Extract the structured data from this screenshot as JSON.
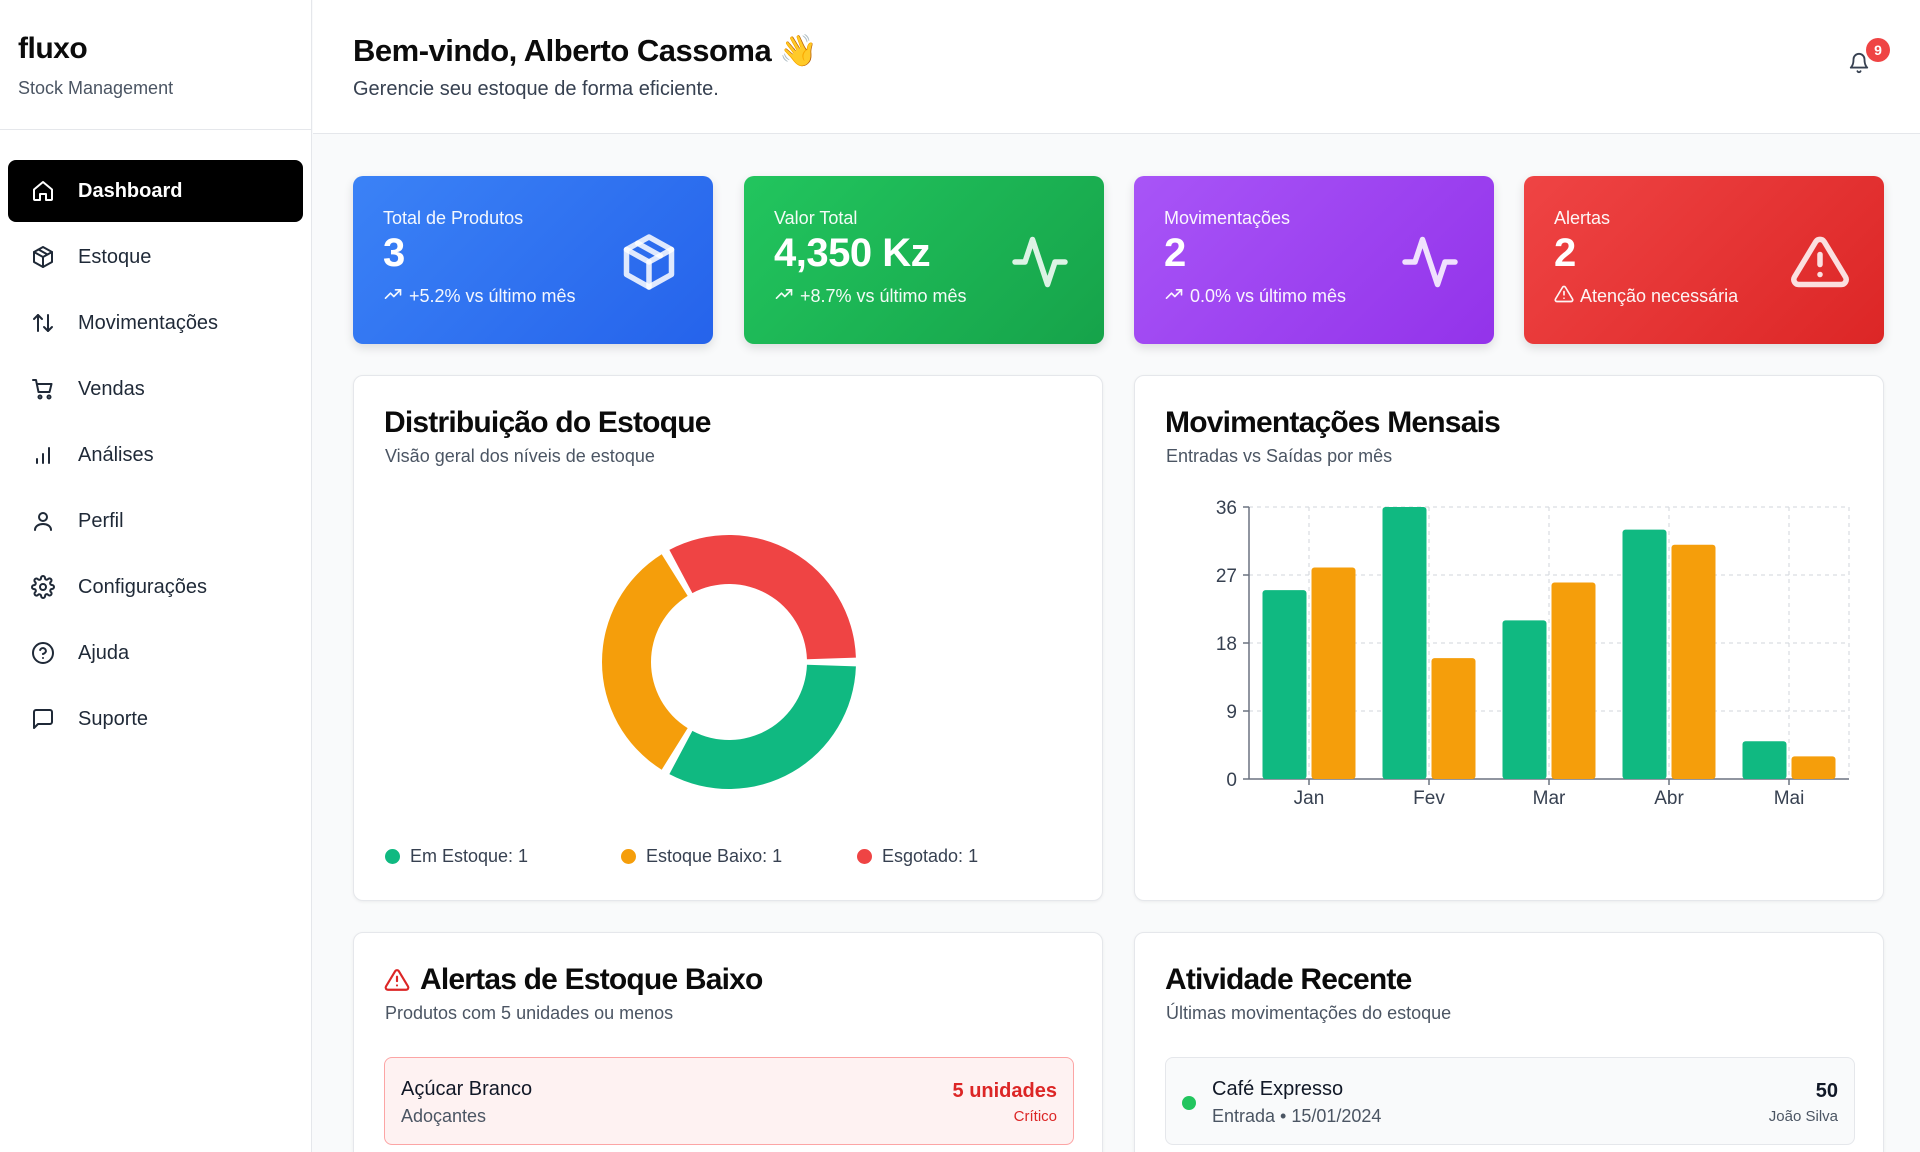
{
  "sidebar": {
    "brand": "fluxo",
    "subtitle": "Stock Management",
    "items": [
      {
        "label": "Dashboard",
        "icon": "home-icon",
        "active": true
      },
      {
        "label": "Estoque",
        "icon": "package-icon"
      },
      {
        "label": "Movimentações",
        "icon": "arrows-up-down-icon"
      },
      {
        "label": "Vendas",
        "icon": "cart-icon"
      },
      {
        "label": "Análises",
        "icon": "bar-chart-icon"
      },
      {
        "label": "Perfil",
        "icon": "user-icon"
      },
      {
        "label": "Configurações",
        "icon": "gear-icon"
      },
      {
        "label": "Ajuda",
        "icon": "help-icon"
      },
      {
        "label": "Suporte",
        "icon": "message-icon"
      }
    ]
  },
  "header": {
    "welcome": "Bem-vindo, Alberto Cassoma 👋",
    "subtitle": "Gerencie seu estoque de forma eficiente.",
    "notifications": "9"
  },
  "stats": [
    {
      "title": "Total de Produtos",
      "value": "3",
      "foot": "+5.2% vs último mês",
      "icon": "box-icon",
      "color": "#2563eb"
    },
    {
      "title": "Valor Total",
      "value": "4,350 Kz",
      "foot": "+8.7% vs último mês",
      "icon": "activity-icon",
      "color": "#16a34a"
    },
    {
      "title": "Movimentações",
      "value": "2",
      "foot": "0.0% vs último mês",
      "icon": "activity-icon",
      "color": "#9333ea"
    },
    {
      "title": "Alertas",
      "value": "2",
      "foot": "Atenção necessária",
      "icon": "warning-icon",
      "color": "#dc2626"
    }
  ],
  "distribution": {
    "title": "Distribuição do Estoque",
    "subtitle": "Visão geral dos níveis de estoque",
    "legend": [
      "Em Estoque: 1",
      "Estoque Baixo: 1",
      "Esgotado: 1"
    ]
  },
  "movements": {
    "title": "Movimentações Mensais",
    "subtitle": "Entradas vs Saídas por mês"
  },
  "alerts": {
    "title": "Alertas de Estoque Baixo",
    "subtitle": "Produtos com 5 unidades ou menos",
    "item": {
      "name": "Açúcar Branco",
      "category": "Adoçantes",
      "qty": "5 unidades",
      "status": "Crítico"
    }
  },
  "activity": {
    "title": "Atividade Recente",
    "subtitle": "Últimas movimentações do estoque",
    "item": {
      "name": "Café Expresso",
      "meta": "Entrada • 15/01/2024",
      "qty": "50",
      "user": "João Silva"
    }
  },
  "chart_data": [
    {
      "type": "pie",
      "categories": [
        "Em Estoque",
        "Estoque Baixo",
        "Esgotado"
      ],
      "values": [
        1,
        1,
        1
      ],
      "colors": [
        "#10b981",
        "#f59e0b",
        "#ef4444"
      ],
      "donut": true
    },
    {
      "type": "bar",
      "categories": [
        "Jan",
        "Fev",
        "Mar",
        "Abr",
        "Mai"
      ],
      "series": [
        {
          "values": [
            25,
            36,
            21,
            33,
            5
          ],
          "color": "#10b981"
        },
        {
          "values": [
            28,
            16,
            26,
            31,
            3
          ],
          "color": "#f59e0b"
        }
      ],
      "yticks": [
        "0",
        "9",
        "18",
        "27",
        "36"
      ],
      "ylim": [
        0,
        36
      ],
      "grid": true
    }
  ]
}
